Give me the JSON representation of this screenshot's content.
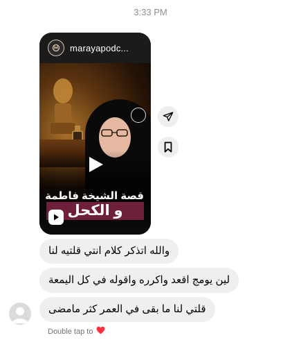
{
  "timestamp": "3:33 PM",
  "reel": {
    "username": "marayapodc...",
    "title_line1": "قصة الشيخة فاطمة",
    "title_line2": "و الكحل"
  },
  "messages": [
    {
      "text": "والله اتذكر كلام انتي قلتيه لنا"
    },
    {
      "text": "لين يومج اقعد واكرره واقوله في كل اليمعة"
    },
    {
      "text": "قلتي لنا ما بقى في العمر كثر مامضى"
    }
  ],
  "footer": {
    "hint": "Double tap to",
    "heart_icon": "heart-icon",
    "heart_color": "#ff3040"
  },
  "actions": {
    "share_icon": "send-icon",
    "save_icon": "bookmark-icon"
  }
}
